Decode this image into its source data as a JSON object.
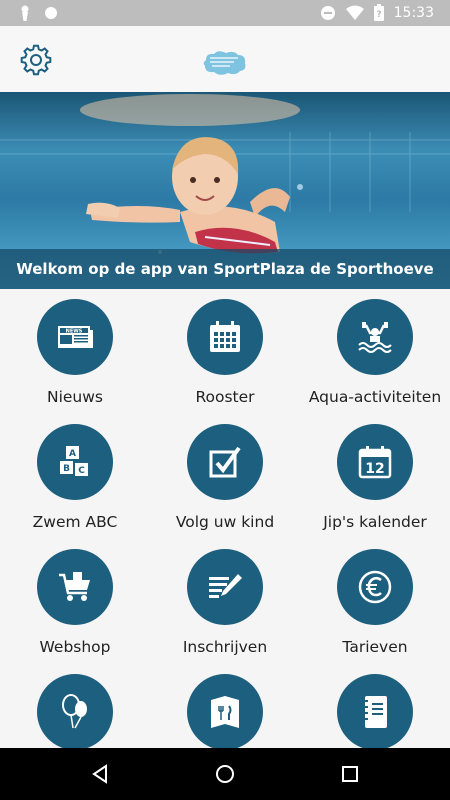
{
  "status_bar": {
    "time": "15:33",
    "left_icons": [
      "keyhole-icon",
      "circle-icon"
    ],
    "right_icons": [
      "do-not-disturb-icon",
      "wifi-icon",
      "battery-icon"
    ]
  },
  "app_bar": {
    "settings_icon": "gear-icon",
    "logo": "sportplaza-logo"
  },
  "hero": {
    "caption": "Welkom op de app van SportPlaza de Sporthoeve"
  },
  "tiles": [
    {
      "label": "Nieuws",
      "icon": "newspaper-icon"
    },
    {
      "label": "Rooster",
      "icon": "calendar-grid-icon"
    },
    {
      "label": "Aqua-activiteiten",
      "icon": "swimmer-weights-icon"
    },
    {
      "label": "Zwem ABC",
      "icon": "abc-blocks-icon"
    },
    {
      "label": "Volg uw kind",
      "icon": "checkbox-icon"
    },
    {
      "label": "Jip's kalender",
      "icon": "calendar-12-icon"
    },
    {
      "label": "Webshop",
      "icon": "shopping-cart-icon"
    },
    {
      "label": "Inschrijven",
      "icon": "write-icon"
    },
    {
      "label": "Tarieven",
      "icon": "euro-icon"
    },
    {
      "label": "",
      "icon": "balloons-icon"
    },
    {
      "label": "",
      "icon": "menu-card-icon"
    },
    {
      "label": "",
      "icon": "notebook-icon"
    }
  ],
  "colors": {
    "tile_circle": "#1d5f7e",
    "caption_bar": "#1a5f80",
    "status_bar": "#bdbdbd"
  },
  "nav_bar": {
    "buttons": [
      "back-icon",
      "home-icon",
      "recents-icon"
    ]
  }
}
